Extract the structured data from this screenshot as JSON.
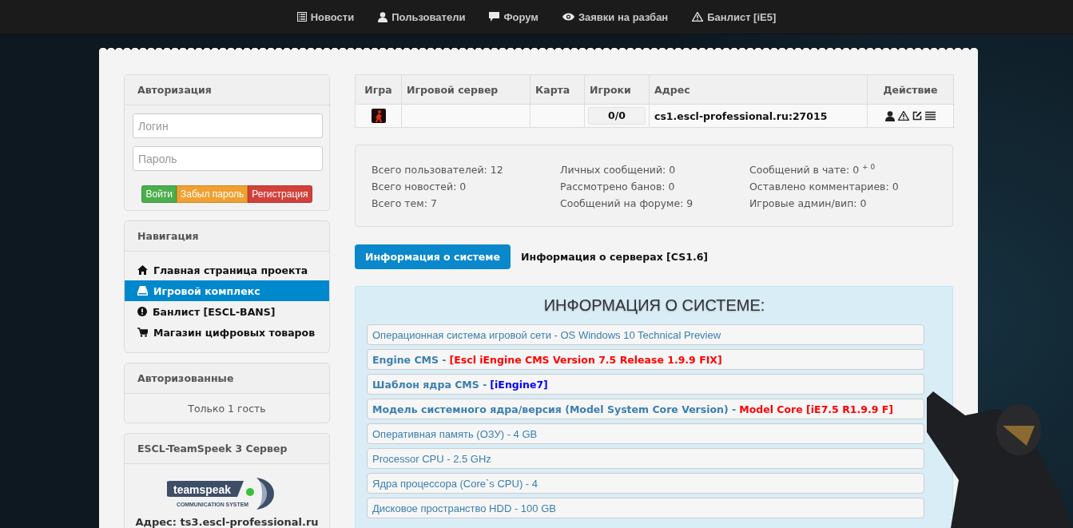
{
  "top_nav": [
    {
      "label": "Новости"
    },
    {
      "label": "Пользователи"
    },
    {
      "label": "Форум"
    },
    {
      "label": "Заявки на разбан"
    },
    {
      "label": "Банлист [iE5]"
    }
  ],
  "sidebar": {
    "auth": {
      "title": "Авторизация",
      "login": {
        "placeholder": "Логин"
      },
      "password": {
        "placeholder": "Пароль"
      },
      "buttons": [
        {
          "label": "Войти",
          "kind": "success"
        },
        {
          "label": "Забыл пароль",
          "kind": "warning"
        },
        {
          "label": "Регистрация",
          "kind": "danger"
        }
      ]
    },
    "navigation": {
      "title": "Навигация",
      "items": [
        {
          "label": "Главная страница проекта",
          "selected": false
        },
        {
          "label": "Игровой комплекс",
          "selected": true
        },
        {
          "label": "Банлист [ESCL-BANS]",
          "selected": false
        },
        {
          "label": "Магазин цифровых товаров",
          "selected": false
        }
      ]
    },
    "online": {
      "title": "Авторизованные",
      "text": "Только 1 гость"
    },
    "teamspeak": {
      "title": "ESCL-TeamSpeek 3 Сервер",
      "logo_word": "teamspeak",
      "logo_tagline": "COMMUNICATION SYSTEM",
      "address": "Адрес: ts3.escl-professional.ru"
    }
  },
  "server_table": {
    "columns": [
      "Игра",
      "Игровой сервер",
      "Карта",
      "Игроки",
      "Адрес",
      "Действие"
    ],
    "rows": [
      {
        "server": "",
        "map": "",
        "players": "0/0",
        "address": "cs1.escl-professional.ru:27015"
      }
    ]
  },
  "stats": [
    [
      "Всего пользователей: 12",
      "Всего новостей: 0",
      "Всего тем: 7"
    ],
    [
      "Личных сообщений: 0",
      "Рассмотрено банов: 0",
      "Сообщений на форуме: 9"
    ],
    [
      "Сообщений в чате: 0 $^{+ 0}$",
      "Оставлено комментариев: 0",
      "Игровые админ/вип: 0"
    ]
  ],
  "tabs": [
    {
      "label": "Информация о системе",
      "selected": true
    },
    {
      "label": "Информация о серверах [CS1.6]",
      "selected": false
    }
  ],
  "system_info": {
    "title": "ИНФОРМАЦИЯ О СИСТЕМЕ:",
    "rows": [
      {
        "kind": "plain",
        "text": "Операционная система игровой сети - OS Windows 10 Technical Preview"
      },
      {
        "kind": "highlight",
        "label": "Engine CMS -",
        "value": "[Escl iEngine CMS Version 7.5 Release 1.9.9 FIX]",
        "color": "#ff0000"
      },
      {
        "kind": "highlight",
        "label": "Шаблон ядра CMS -",
        "value": "[iEngine7]",
        "color": "#0000ff"
      },
      {
        "kind": "highlight",
        "label": "Модель системного ядра/версия (Model System Core Version) -",
        "value": "Model Core [iE7.5 R1.9.9 F]",
        "color": "#ff0000"
      },
      {
        "kind": "plain",
        "text": "Оперативная память (ОЗУ) - 4 GB"
      },
      {
        "kind": "plain",
        "text": "Processor CPU - 2.5 GHz"
      },
      {
        "kind": "plain",
        "text": "Ядра процессора (Core`s CPU) - 4"
      },
      {
        "kind": "plain",
        "text": "Дисковое пространство HDD - 100 GB"
      }
    ]
  }
}
